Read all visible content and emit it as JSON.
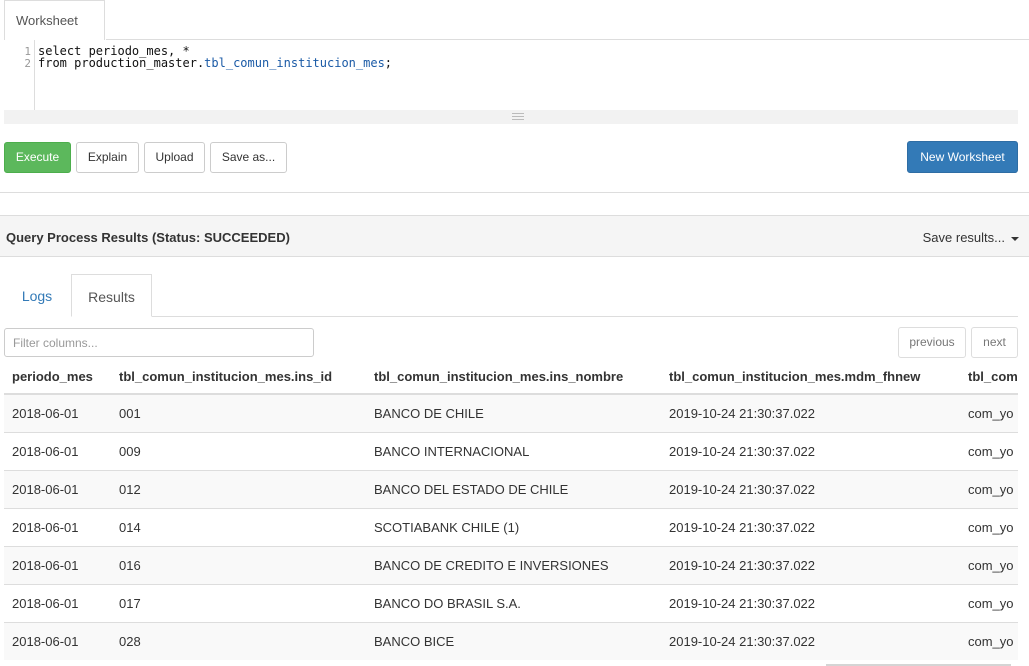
{
  "worksheet_tab": "Worksheet",
  "editor": {
    "line_numbers": [
      "1",
      "2"
    ],
    "line1": "select periodo_mes, *",
    "line2_prefix": "from production_master.",
    "line2_table": "tbl_comun_institucion_mes",
    "line2_suffix": ";"
  },
  "toolbar": {
    "execute": "Execute",
    "explain": "Explain",
    "upload": "Upload",
    "save_as": "Save as...",
    "new_worksheet": "New Worksheet"
  },
  "results_panel": {
    "title": "Query Process Results (Status: SUCCEEDED)",
    "save_results": "Save results...",
    "tabs": [
      "Logs",
      "Results"
    ],
    "active_tab": "Results",
    "filter_placeholder": "Filter columns...",
    "previous": "previous",
    "next": "next"
  },
  "table": {
    "headers": [
      "periodo_mes",
      "tbl_comun_institucion_mes.ins_id",
      "tbl_comun_institucion_mes.ins_nombre",
      "tbl_comun_institucion_mes.mdm_fhnew",
      "tbl_comun_institucion_mes.mdm_usernew"
    ],
    "rows": [
      [
        "2018-06-01",
        "001",
        "BANCO DE CHILE",
        "2019-10-24 21:30:37.022",
        "com_yo"
      ],
      [
        "2018-06-01",
        "009",
        "BANCO INTERNACIONAL",
        "2019-10-24 21:30:37.022",
        "com_yo"
      ],
      [
        "2018-06-01",
        "012",
        "BANCO DEL ESTADO DE CHILE",
        "2019-10-24 21:30:37.022",
        "com_yo"
      ],
      [
        "2018-06-01",
        "014",
        "SCOTIABANK CHILE (1)",
        "2019-10-24 21:30:37.022",
        "com_yo"
      ],
      [
        "2018-06-01",
        "016",
        "BANCO DE CREDITO E INVERSIONES",
        "2019-10-24 21:30:37.022",
        "com_yo"
      ],
      [
        "2018-06-01",
        "017",
        "BANCO DO BRASIL S.A.",
        "2019-10-24 21:30:37.022",
        "com_yo"
      ],
      [
        "2018-06-01",
        "028",
        "BANCO BICE",
        "2019-10-24 21:30:37.022",
        "com_yo"
      ]
    ]
  },
  "colors": {
    "execute": "#5cb85c",
    "new_worksheet": "#337ab7",
    "link": "#337ab7",
    "sql_table": "#1a5aa6"
  }
}
